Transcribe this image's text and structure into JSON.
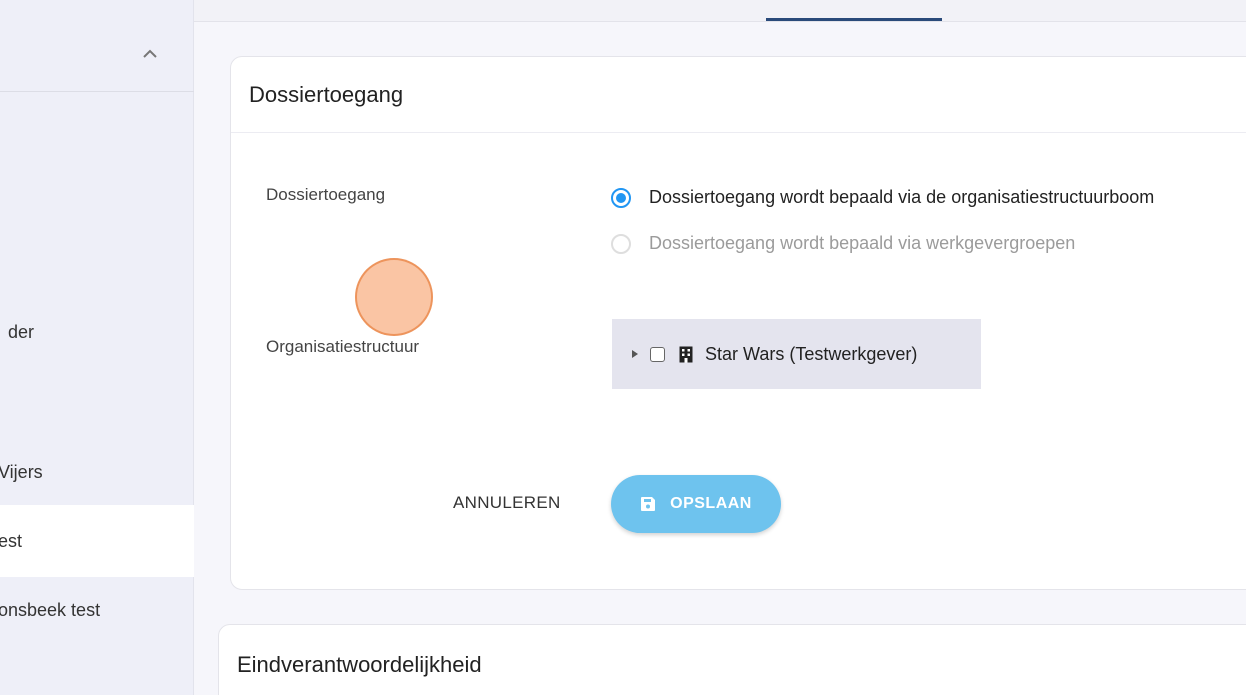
{
  "sidebar": {
    "items": [
      {
        "label": "der"
      },
      {
        "label": "Vijers"
      },
      {
        "label": "est"
      },
      {
        "label": "onsbeek test"
      }
    ]
  },
  "card1": {
    "title": "Dossiertoegang",
    "access_label": "Dossiertoegang",
    "radio_options": [
      {
        "label": "Dossiertoegang wordt bepaald via de organisatiestructuurboom",
        "selected": true
      },
      {
        "label": "Dossiertoegang wordt bepaald via werkgevergroepen",
        "selected": false
      }
    ],
    "org_label": "Organisatiestructuur",
    "tree_node_label": "Star Wars (Testwerkgever)",
    "cancel_label": "ANNULEREN",
    "save_label": "OPSLAAN"
  },
  "card2": {
    "title": "Eindverantwoordelijkheid"
  },
  "colors": {
    "accent": "#2196f3",
    "save_button": "#6ec3ee",
    "tab_indicator": "#2a4a7a"
  }
}
